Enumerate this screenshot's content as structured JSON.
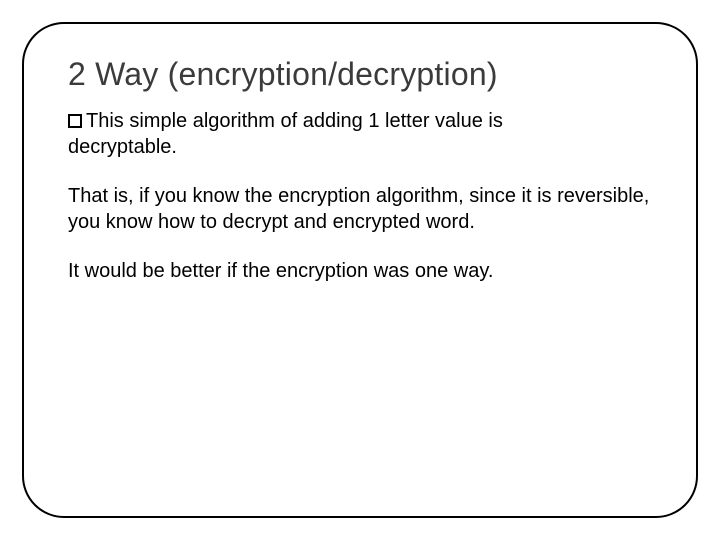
{
  "title": "2 Way (encryption/decryption)",
  "bullet": {
    "line1": "This simple algorithm of adding 1 letter value is",
    "line2": "decryptable."
  },
  "para1": "That is, if you know the encryption algorithm, since it is reversible, you know how to decrypt and encrypted word.",
  "para2": "It would be better if the encryption was one way."
}
